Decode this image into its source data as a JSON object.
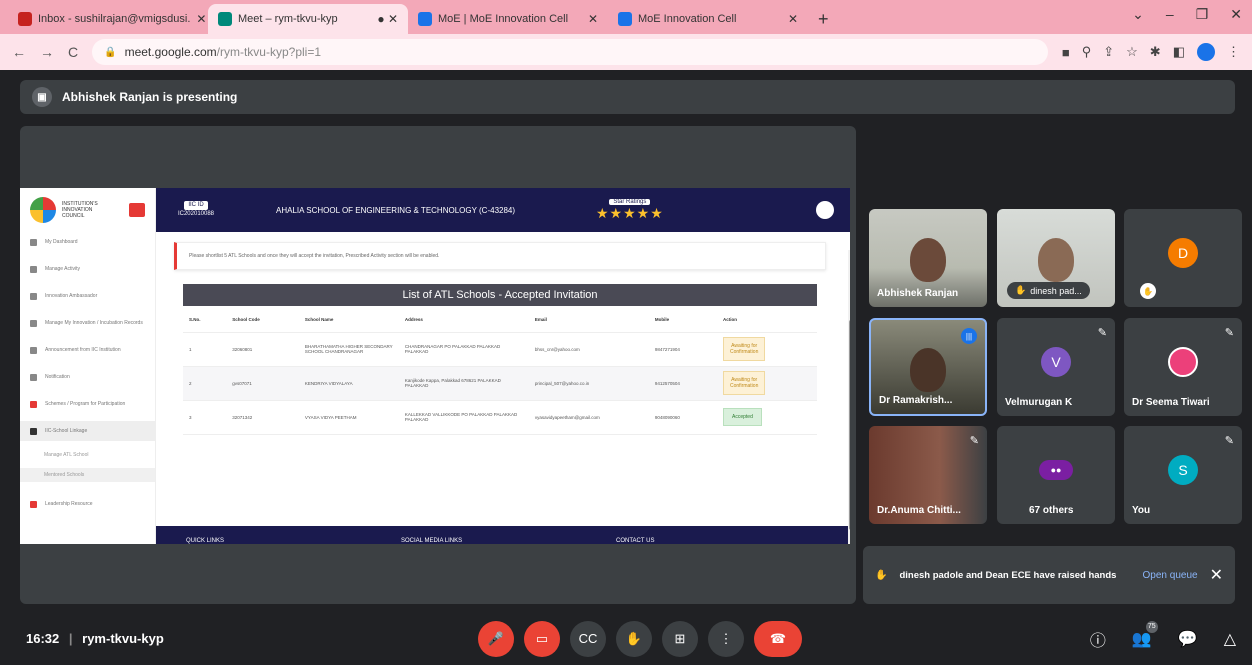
{
  "browser": {
    "tabs": [
      {
        "label": "Inbox - sushilrajan@vmigsdusi.",
        "icon_color": "#c5221f"
      },
      {
        "label": "Meet – rym-tkvu-kyp",
        "icon_color": "#00897b"
      },
      {
        "label": "MoE | MoE Innovation Cell",
        "icon_color": "#1a73e8"
      },
      {
        "label": "MoE Innovation Cell",
        "icon_color": "#1a73e8"
      }
    ],
    "new_tab": "+",
    "url_host": "meet.google.com",
    "url_path": "/rym-tkvu-kyp?pli=1"
  },
  "presenting": {
    "text": "Abhishek Ranjan is presenting"
  },
  "shared_screen": {
    "sidebar": {
      "logo_text": "INSTITUTION'S INNOVATION COUNCIL",
      "items": [
        "My Dashboard",
        "Manage Activity",
        "Innovation Ambassador",
        "Manage My Innovation / Incubation Records",
        "Announcement from IIC Institution",
        "Notification",
        "Schemes / Program for Participation",
        "IIC-School Linkage"
      ],
      "sub_items": [
        "Manage ATL School",
        "Mentored Schools"
      ],
      "bottom_item": "Leadership Resource"
    },
    "header": {
      "id_tag": "IIC ID",
      "id_value": "IC202010088",
      "institute": "AHALIA SCHOOL OF ENGINEERING & TECHNOLOGY (C-43284)",
      "star_tag": "Star Ratings",
      "stars": "★★★★★"
    },
    "notice": "Please shortlist 5 ATL Schools and once they will accept the invitation, Prescribed Activity section will be enabled.",
    "table": {
      "title": "List of ATL Schools - Accepted Invitation",
      "columns": [
        "S.No.",
        "School Code",
        "School Name",
        "Address",
        "Email",
        "Mobile",
        "Action"
      ],
      "rows": [
        {
          "sno": "1",
          "code": "32060801",
          "name": "BHARATHAMATHA HIGHER SECONDARY SCHOOL CHANDRANAGAR",
          "address": "CHANDRANAGAR PO PALAKKAD PALAKKAD PALAKKAD",
          "email": "bhss_cnr@yahoo.com",
          "mobile": "9847271904",
          "action_l1": "Awaiting for",
          "action_l2": "Confirmation"
        },
        {
          "sno": "2",
          "code": "gvs07071",
          "name": "KENDRIYA VIDYALAYA",
          "address": "Kanjikode Kappa, Palakkad 678621 PALAKKAD PALAKKAD",
          "email": "principal_507@yahoo.co.in",
          "mobile": "9412570504",
          "action_l1": "Awaiting for",
          "action_l2": "Confirmation"
        },
        {
          "sno": "3",
          "code": "32071342",
          "name": "VYASA VIDYA PEETHAM",
          "address": "KALLEKKAD VALLIKKODE PO PALAKKAD PALAKKAD PALAKKAD",
          "email": "vyasavidyapeetham@gmail.com",
          "mobile": "9048090060",
          "action_l1": "Accepted",
          "action_l2": ""
        }
      ]
    },
    "footer": {
      "quick_links": "QUICK LINKS",
      "social": "SOCIAL MEDIA LINKS",
      "contact": "CONTACT US"
    }
  },
  "participants": [
    {
      "name": "Abhishek Ranjan",
      "initial": "",
      "color": ""
    },
    {
      "name": "dinesh pad...",
      "initial": "",
      "color": ""
    },
    {
      "name": "",
      "initial": "D",
      "color": "#f57c00"
    },
    {
      "name": "Dr Ramakrish...",
      "initial": "",
      "color": ""
    },
    {
      "name": "Velmurugan K",
      "initial": "V",
      "color": "#7e57c2"
    },
    {
      "name": "Dr Seema Tiwari",
      "initial": "",
      "color": "#ec407a"
    },
    {
      "name": "Dr.Anuma Chitti...",
      "initial": "",
      "color": ""
    },
    {
      "name": "67 others",
      "initial": "",
      "color": ""
    },
    {
      "name": "You",
      "initial": "S",
      "color": "#00acc1"
    }
  ],
  "notification": {
    "text": "dinesh padole and Dean ECE have raised hands",
    "action": "Open queue"
  },
  "bottom": {
    "time": "16:32",
    "separator": "|",
    "meeting_code": "rym-tkvu-kyp",
    "people_count": "75"
  }
}
